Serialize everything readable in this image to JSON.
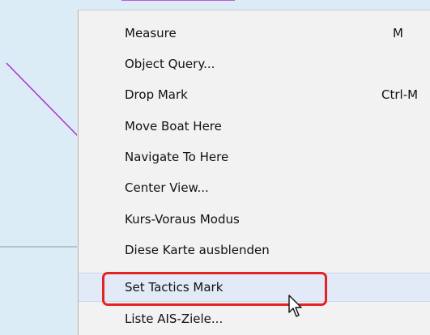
{
  "context_menu": {
    "items": [
      {
        "label": "Measure",
        "shortcut": "M"
      },
      {
        "label": "Object Query...",
        "shortcut": ""
      },
      {
        "label": "Drop Mark",
        "shortcut": "Ctrl-M"
      },
      {
        "label": "Move Boat Here",
        "shortcut": ""
      },
      {
        "label": "Navigate To Here",
        "shortcut": ""
      },
      {
        "label": "Center View...",
        "shortcut": ""
      },
      {
        "label": "Kurs-Voraus Modus",
        "shortcut": ""
      },
      {
        "label": "Diese Karte ausblenden",
        "shortcut": ""
      },
      {
        "label": "Set Tactics Mark",
        "shortcut": ""
      },
      {
        "label": "Liste AIS-Ziele...",
        "shortcut": ""
      }
    ],
    "highlighted_item": "Set Tactics Mark"
  },
  "colors": {
    "map_background": "#dcecf7",
    "route_line": "#b030c8",
    "menu_background": "#f2f2f2",
    "highlight_box": "#e52222"
  }
}
